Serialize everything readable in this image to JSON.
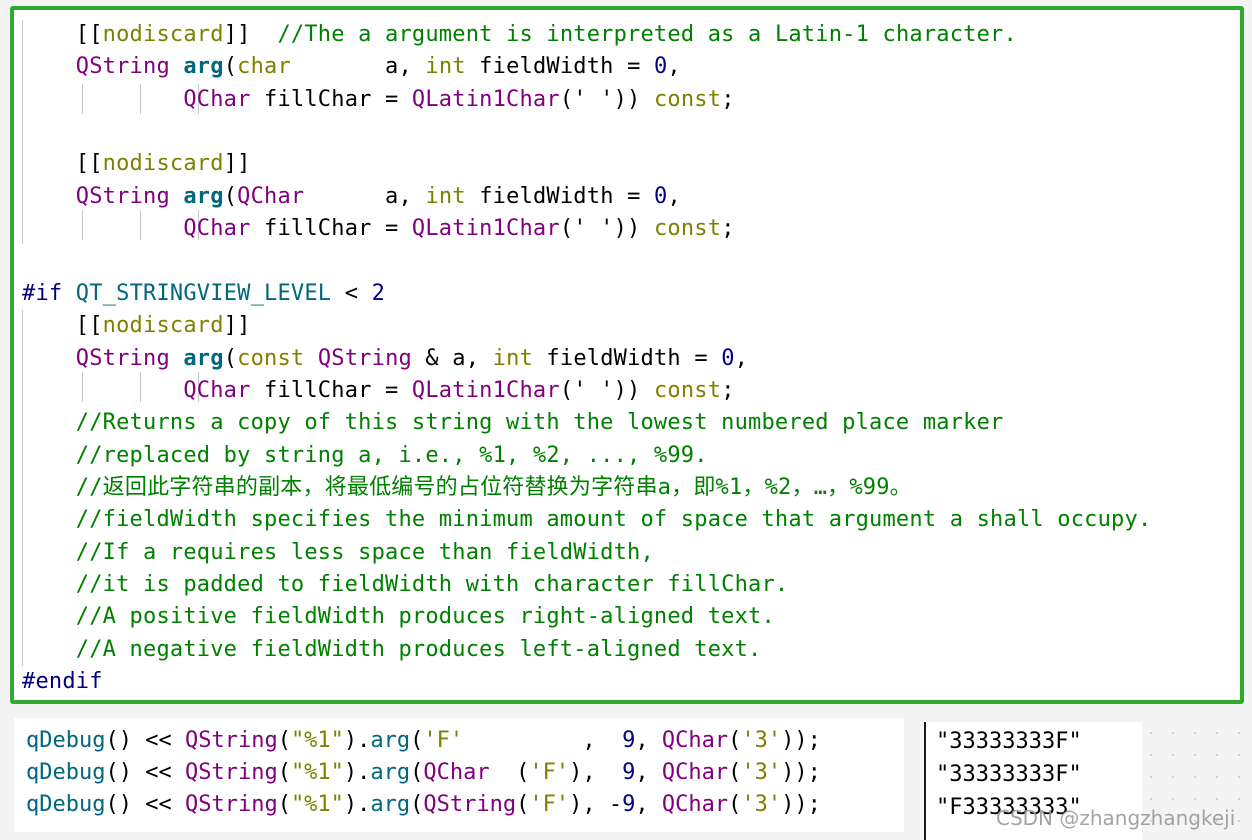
{
  "editor": {
    "lines": [
      {
        "segs": [
          [
            "    ",
            ""
          ],
          [
            "[[",
            "plain"
          ],
          [
            "nodiscard",
            "kw"
          ],
          [
            "]]  ",
            "plain"
          ],
          [
            "//The a argument is interpreted as a Latin-1 character.",
            "cm"
          ]
        ]
      },
      {
        "segs": [
          [
            "    ",
            ""
          ],
          [
            "QString",
            "ty"
          ],
          [
            " ",
            ""
          ],
          [
            "arg",
            "fn"
          ],
          [
            "(",
            "plain"
          ],
          [
            "char",
            "kw"
          ],
          [
            "       a, ",
            "plain"
          ],
          [
            "int",
            "kw"
          ],
          [
            " fieldWidth = ",
            "plain"
          ],
          [
            "0",
            "num"
          ],
          [
            ",",
            "plain"
          ]
        ]
      },
      {
        "segs": [
          [
            "            ",
            ""
          ],
          [
            "QChar",
            "ty"
          ],
          [
            " fillChar = ",
            "plain"
          ],
          [
            "QLatin1Char",
            "ty"
          ],
          [
            "(' ')) ",
            "plain"
          ],
          [
            "const",
            "kw"
          ],
          [
            ";",
            "plain"
          ]
        ]
      },
      {
        "segs": []
      },
      {
        "segs": [
          [
            "    ",
            ""
          ],
          [
            "[[",
            "plain"
          ],
          [
            "nodiscard",
            "kw"
          ],
          [
            "]]",
            "plain"
          ]
        ]
      },
      {
        "segs": [
          [
            "    ",
            ""
          ],
          [
            "QString",
            "ty"
          ],
          [
            " ",
            ""
          ],
          [
            "arg",
            "fn"
          ],
          [
            "(",
            "plain"
          ],
          [
            "QChar",
            "ty"
          ],
          [
            "      a, ",
            "plain"
          ],
          [
            "int",
            "kw"
          ],
          [
            " fieldWidth = ",
            "plain"
          ],
          [
            "0",
            "num"
          ],
          [
            ",",
            "plain"
          ]
        ]
      },
      {
        "segs": [
          [
            "            ",
            ""
          ],
          [
            "QChar",
            "ty"
          ],
          [
            " fillChar = ",
            "plain"
          ],
          [
            "QLatin1Char",
            "ty"
          ],
          [
            "(' ')) ",
            "plain"
          ],
          [
            "const",
            "kw"
          ],
          [
            ";",
            "plain"
          ]
        ]
      },
      {
        "segs": []
      },
      {
        "segs": [
          [
            "#if",
            "pp"
          ],
          [
            " ",
            ""
          ],
          [
            "QT_STRINGVIEW_LEVEL",
            "mac"
          ],
          [
            " < ",
            "plain"
          ],
          [
            "2",
            "num"
          ]
        ]
      },
      {
        "segs": [
          [
            "    ",
            ""
          ],
          [
            "[[",
            "plain"
          ],
          [
            "nodiscard",
            "kw"
          ],
          [
            "]]",
            "plain"
          ]
        ]
      },
      {
        "segs": [
          [
            "    ",
            ""
          ],
          [
            "QString",
            "ty"
          ],
          [
            " ",
            ""
          ],
          [
            "arg",
            "fn"
          ],
          [
            "(",
            "plain"
          ],
          [
            "const",
            "kw"
          ],
          [
            " ",
            ""
          ],
          [
            "QString",
            "ty"
          ],
          [
            " & a, ",
            "plain"
          ],
          [
            "int",
            "kw"
          ],
          [
            " fieldWidth = ",
            "plain"
          ],
          [
            "0",
            "num"
          ],
          [
            ",",
            "plain"
          ]
        ]
      },
      {
        "segs": [
          [
            "            ",
            ""
          ],
          [
            "QChar",
            "ty"
          ],
          [
            " fillChar = ",
            "plain"
          ],
          [
            "QLatin1Char",
            "ty"
          ],
          [
            "(' ')) ",
            "plain"
          ],
          [
            "const",
            "kw"
          ],
          [
            ";",
            "plain"
          ]
        ]
      },
      {
        "segs": [
          [
            "    ",
            ""
          ],
          [
            "//Returns a copy of this string with the lowest numbered place marker",
            "cm"
          ]
        ]
      },
      {
        "segs": [
          [
            "    ",
            ""
          ],
          [
            "//replaced by string a, i.e., %1, %2, ..., %99.",
            "cm"
          ]
        ]
      },
      {
        "segs": [
          [
            "    ",
            ""
          ],
          [
            "//返回此字符串的副本，将最低编号的占位符替换为字符串a，即%1，%2，…，%99。",
            "cm"
          ]
        ]
      },
      {
        "segs": [
          [
            "    ",
            ""
          ],
          [
            "//fieldWidth specifies the minimum amount of space that argument a shall occupy.",
            "cm"
          ]
        ]
      },
      {
        "segs": [
          [
            "    ",
            ""
          ],
          [
            "//If a requires less space than fieldWidth,",
            "cm"
          ]
        ]
      },
      {
        "segs": [
          [
            "    ",
            ""
          ],
          [
            "//it is padded to fieldWidth with character fillChar.",
            "cm"
          ]
        ]
      },
      {
        "segs": [
          [
            "    ",
            ""
          ],
          [
            "//A positive fieldWidth produces right-aligned text.",
            "cm"
          ]
        ]
      },
      {
        "segs": [
          [
            "    ",
            ""
          ],
          [
            "//A negative fieldWidth produces left-aligned text.",
            "cm"
          ]
        ]
      },
      {
        "segs": [
          [
            "#endif",
            "pp"
          ]
        ]
      }
    ]
  },
  "example_code": {
    "lines": [
      {
        "segs": [
          [
            "qDebug",
            "mac"
          ],
          [
            "() << ",
            "plain"
          ],
          [
            "QString",
            "ty"
          ],
          [
            "(",
            "plain"
          ],
          [
            "\"%1\"",
            "kw"
          ],
          [
            ").",
            "plain"
          ],
          [
            "arg",
            "mac"
          ],
          [
            "(",
            "plain"
          ],
          [
            "'F'",
            "kw"
          ],
          [
            "         ,  ",
            "plain"
          ],
          [
            "9",
            "num"
          ],
          [
            ", ",
            "plain"
          ],
          [
            "QChar",
            "ty"
          ],
          [
            "(",
            "plain"
          ],
          [
            "'3'",
            "kw"
          ],
          [
            "));",
            "plain"
          ]
        ]
      },
      {
        "segs": [
          [
            "qDebug",
            "mac"
          ],
          [
            "() << ",
            "plain"
          ],
          [
            "QString",
            "ty"
          ],
          [
            "(",
            "plain"
          ],
          [
            "\"%1\"",
            "kw"
          ],
          [
            ").",
            "plain"
          ],
          [
            "arg",
            "mac"
          ],
          [
            "(",
            "plain"
          ],
          [
            "QChar",
            "ty"
          ],
          [
            "  (",
            "plain"
          ],
          [
            "'F'",
            "kw"
          ],
          [
            "),  ",
            "plain"
          ],
          [
            "9",
            "num"
          ],
          [
            ", ",
            "plain"
          ],
          [
            "QChar",
            "ty"
          ],
          [
            "(",
            "plain"
          ],
          [
            "'3'",
            "kw"
          ],
          [
            "));",
            "plain"
          ]
        ]
      },
      {
        "segs": [
          [
            "qDebug",
            "mac"
          ],
          [
            "() << ",
            "plain"
          ],
          [
            "QString",
            "ty"
          ],
          [
            "(",
            "plain"
          ],
          [
            "\"%1\"",
            "kw"
          ],
          [
            ").",
            "plain"
          ],
          [
            "arg",
            "mac"
          ],
          [
            "(",
            "plain"
          ],
          [
            "QString",
            "ty"
          ],
          [
            "(",
            "plain"
          ],
          [
            "'F'",
            "kw"
          ],
          [
            "), -",
            "plain"
          ],
          [
            "9",
            "num"
          ],
          [
            ", ",
            "plain"
          ],
          [
            "QChar",
            "ty"
          ],
          [
            "(",
            "plain"
          ],
          [
            "'3'",
            "kw"
          ],
          [
            "));",
            "plain"
          ]
        ]
      }
    ]
  },
  "console_output": {
    "lines": [
      "\"33333333F\"",
      "\"33333333F\"",
      "\"F33333333\""
    ]
  },
  "watermark": "CSDN @zhangzhangkeji",
  "colors": {
    "border": "#2eaa2e",
    "keyword": "#808000",
    "type": "#800080",
    "function": "#00677c",
    "number": "#000080",
    "comment": "#008000"
  }
}
